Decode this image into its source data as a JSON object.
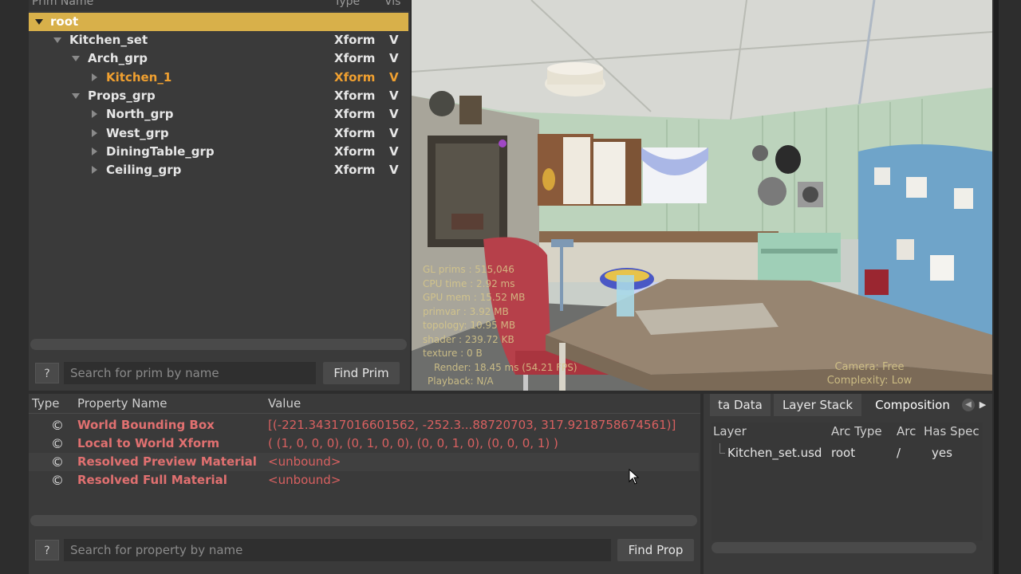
{
  "prim_tree": {
    "headers": {
      "name": "Prim Name",
      "type": "Type",
      "vis": "Vis"
    },
    "rows": [
      {
        "name": "root",
        "type": "",
        "vis": ""
      },
      {
        "name": "Kitchen_set",
        "type": "Xform",
        "vis": "V"
      },
      {
        "name": "Arch_grp",
        "type": "Xform",
        "vis": "V"
      },
      {
        "name": "Kitchen_1",
        "type": "Xform",
        "vis": "V"
      },
      {
        "name": "Props_grp",
        "type": "Xform",
        "vis": "V"
      },
      {
        "name": "North_grp",
        "type": "Xform",
        "vis": "V"
      },
      {
        "name": "West_grp",
        "type": "Xform",
        "vis": "V"
      },
      {
        "name": "DiningTable_grp",
        "type": "Xform",
        "vis": "V"
      },
      {
        "name": "Ceiling_grp",
        "type": "Xform",
        "vis": "V"
      }
    ],
    "help_label": "?",
    "search_placeholder": "Search for prim by name",
    "find_button": "Find Prim"
  },
  "viewport": {
    "hud_left": [
      "GL prims : 515,046",
      "CPU time : 2.92 ms",
      "GPU mem : 15.52 MB",
      "primvar : 3.92 MB",
      "topology: 10.95 MB",
      "shader : 239.72 KB",
      "texture : 0 B",
      "Render: 18.45 ms (54.21 FPS)",
      "Playback: N/A"
    ],
    "hud_right": [
      "Camera: Free",
      "Complexity: Low"
    ]
  },
  "properties": {
    "headers": {
      "type": "Type",
      "name": "Property Name",
      "value": "Value"
    },
    "rows": [
      {
        "icon": "©",
        "name": "World Bounding Box",
        "value": "[(-221.34317016601562, -252.3...88720703, 317.9218758674561)]"
      },
      {
        "icon": "©",
        "name": "Local to World Xform",
        "value": "( (1, 0, 0, 0), (0, 1, 0, 0), (0, 0, 1, 0), (0, 0, 0, 1) )"
      },
      {
        "icon": "©",
        "name": "Resolved Preview Material",
        "value": "<unbound>"
      },
      {
        "icon": "©",
        "name": "Resolved Full Material",
        "value": "<unbound>"
      }
    ],
    "help_label": "?",
    "search_placeholder": "Search for property by name",
    "find_button": "Find Prop"
  },
  "composition": {
    "tabs": [
      "ta Data",
      "Layer Stack",
      "Composition"
    ],
    "active_tab": "Composition",
    "headers": {
      "layer": "Layer",
      "arc_type": "Arc Type",
      "arc": "Arc",
      "has_spec": "Has Spec"
    },
    "rows": [
      {
        "layer": "Kitchen_set.usd",
        "arc_type": "root",
        "arc": "/",
        "has_spec": "yes"
      }
    ]
  },
  "colors": {
    "selection_row": "#d8b04a",
    "selected_text": "#f0a030",
    "property_name": "#e07070",
    "property_value": "#d86060",
    "panel_bg": "#3a3a3a"
  }
}
